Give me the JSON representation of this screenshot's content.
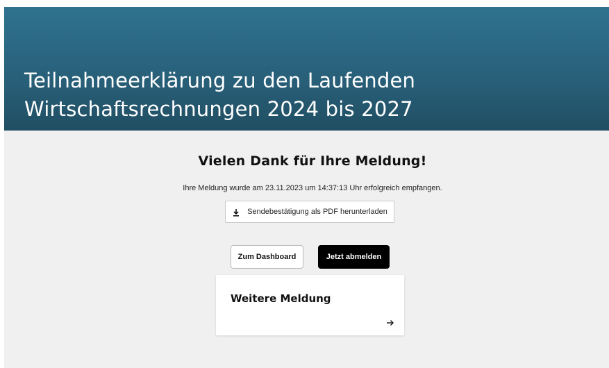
{
  "banner": {
    "title_line1": "Teilnahmeerklärung zu den Laufenden",
    "title_line2": "Wirtschaftsrechnungen 2024 bis 2027"
  },
  "confirmation": {
    "heading": "Vielen Dank für Ihre Meldung!",
    "receipt_text": "Ihre Meldung wurde am 23.11.2023 um 14:37:13 Uhr erfolgreich empfangen.",
    "pdf_button_label": "Sendebestätigung als PDF herunterladen",
    "pdf_button_icon": "download-icon"
  },
  "actions": {
    "dashboard_label": "Zum Dashboard",
    "logout_label": "Jetzt abmelden"
  },
  "card": {
    "title": "Weitere Meldung",
    "icon": "arrow-right-icon"
  },
  "colors": {
    "banner": "#2a6a86",
    "background": "#f0f0f0",
    "primary_button": "#000000"
  }
}
